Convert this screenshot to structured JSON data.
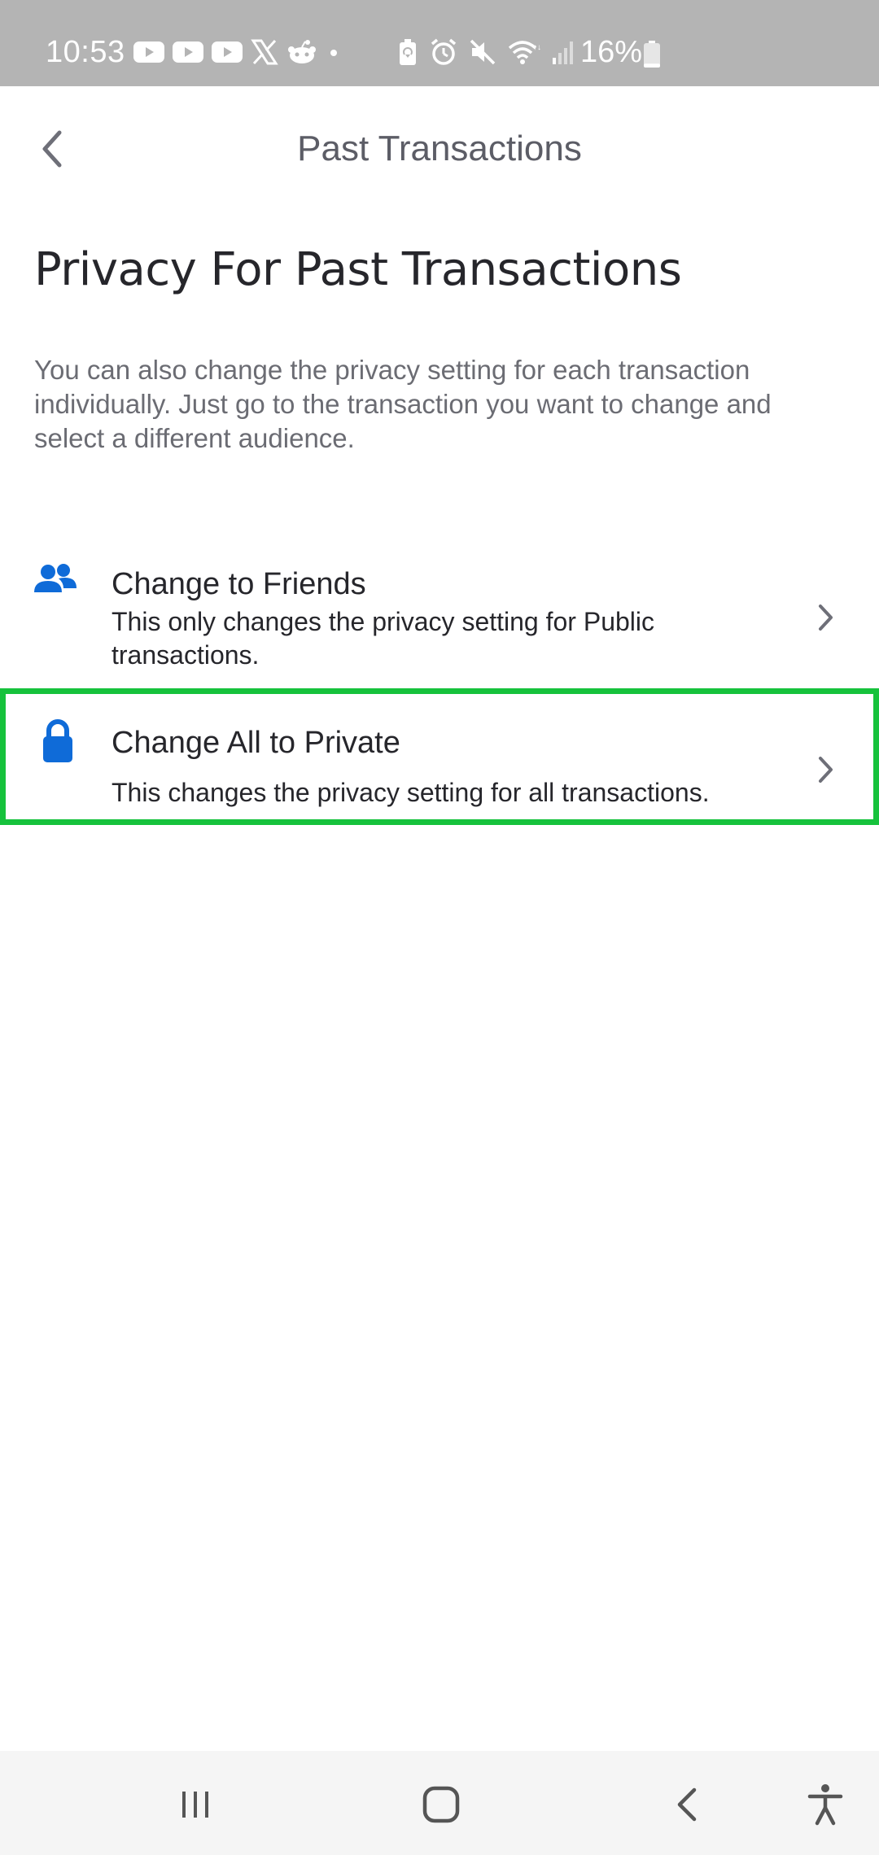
{
  "status_bar": {
    "time": "10:53",
    "battery_percent": "16%",
    "left_icons": [
      "youtube-icon",
      "youtube-icon",
      "youtube-icon",
      "x-icon",
      "reddit-icon",
      "dot-icon"
    ],
    "right_icons": [
      "battery-saver-icon",
      "alarm-icon",
      "mute-icon",
      "wifi-icon",
      "signal-icon",
      "battery-icon"
    ],
    "battery_level": 0.16
  },
  "header": {
    "title": "Past Transactions",
    "back_icon": "chevron-left-icon"
  },
  "page": {
    "title": "Privacy For Past Transactions",
    "description": "You can also change the privacy setting for each transaction individually. Just go to the transaction you want to change and select a different audience."
  },
  "options": [
    {
      "title": "Change to Friends",
      "subtitle": "This only changes the privacy setting for Public transactions.",
      "icon": "friends-icon"
    },
    {
      "title": "Change All to Private",
      "subtitle": "This changes the privacy setting for all transactions.",
      "icon": "lock-icon",
      "highlighted": true
    }
  ],
  "colors": {
    "accent_blue": "#0f6bd8",
    "highlight_border": "#16c23c",
    "status_bar_bg": "#b4b4b4",
    "title_text": "#26262b",
    "secondary_text": "#6b6c73"
  },
  "nav_bar": {
    "icons": [
      "recents-icon",
      "home-icon",
      "back-icon",
      "accessibility-icon"
    ]
  }
}
